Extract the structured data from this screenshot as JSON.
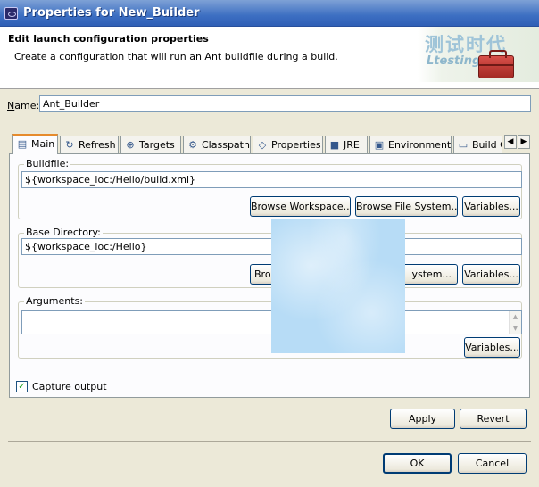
{
  "window": {
    "title": "Properties for New_Builder"
  },
  "header": {
    "title": "Edit launch configuration properties",
    "message": "Create a configuration that will run an Ant buildfile during a build.",
    "watermark_cn": "测试时代",
    "watermark_url": "Ltesting.net"
  },
  "name": {
    "label": "Name:",
    "value": "Ant_Builder"
  },
  "tabs": [
    {
      "label": "Main",
      "icon": "main-tab-icon"
    },
    {
      "label": "Refresh",
      "icon": "refresh-icon"
    },
    {
      "label": "Targets",
      "icon": "targets-icon"
    },
    {
      "label": "Classpath",
      "icon": "classpath-icon"
    },
    {
      "label": "Properties",
      "icon": "properties-icon"
    },
    {
      "label": "JRE",
      "icon": "jre-icon"
    },
    {
      "label": "Environment",
      "icon": "environment-icon"
    },
    {
      "label": "Build O",
      "icon": "build-options-icon"
    }
  ],
  "buildfile": {
    "label": "Buildfile:",
    "value": "${workspace_loc:/Hello/build.xml}",
    "browse_workspace": "Browse Workspace...",
    "browse_file_system": "Browse File System...",
    "variables": "Variables..."
  },
  "base_directory": {
    "label": "Base Directory:",
    "value": "${workspace_loc:/Hello}",
    "browse_workspace_partial": "Brows",
    "browse_file_system_partial": "ystem...",
    "variables": "Variables..."
  },
  "arguments": {
    "label": "Arguments:",
    "value": "",
    "variables": "Variables..."
  },
  "capture_output": {
    "label": "Capture output",
    "checked": true
  },
  "actions": {
    "apply": "Apply",
    "revert": "Revert"
  },
  "dialog": {
    "ok": "OK",
    "cancel": "Cancel"
  }
}
